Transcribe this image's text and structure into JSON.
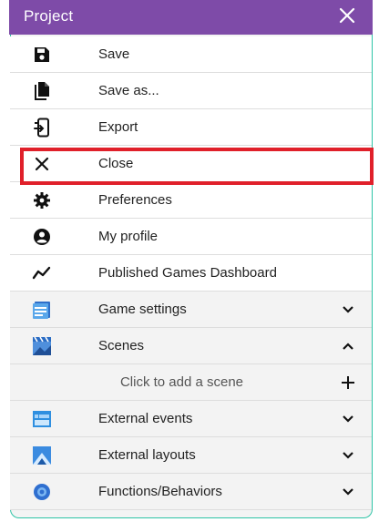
{
  "window": {
    "title": "Project"
  },
  "menu": {
    "items": [
      {
        "label": "Save",
        "icon": "save-icon"
      },
      {
        "label": "Save as...",
        "icon": "save-as-icon"
      },
      {
        "label": "Export",
        "icon": "export-icon"
      },
      {
        "label": "Close",
        "icon": "close-icon"
      },
      {
        "label": "Preferences",
        "icon": "gear-icon"
      },
      {
        "label": "My profile",
        "icon": "profile-icon"
      },
      {
        "label": "Published Games Dashboard",
        "icon": "dashboard-icon"
      }
    ]
  },
  "sections": {
    "game_settings": {
      "label": "Game settings",
      "icon": "game-settings-icon"
    },
    "scenes": {
      "label": "Scenes",
      "icon": "scenes-icon",
      "add_label": "Click to add a scene"
    },
    "external_events": {
      "label": "External events",
      "icon": "external-events-icon"
    },
    "external_layouts": {
      "label": "External layouts",
      "icon": "external-layouts-icon"
    },
    "functions": {
      "label": "Functions/Behaviors",
      "icon": "functions-icon"
    }
  },
  "colors": {
    "titlebar": "#7e4ba8",
    "highlight": "#e0202a",
    "panel_border": "#2ec4a6"
  }
}
